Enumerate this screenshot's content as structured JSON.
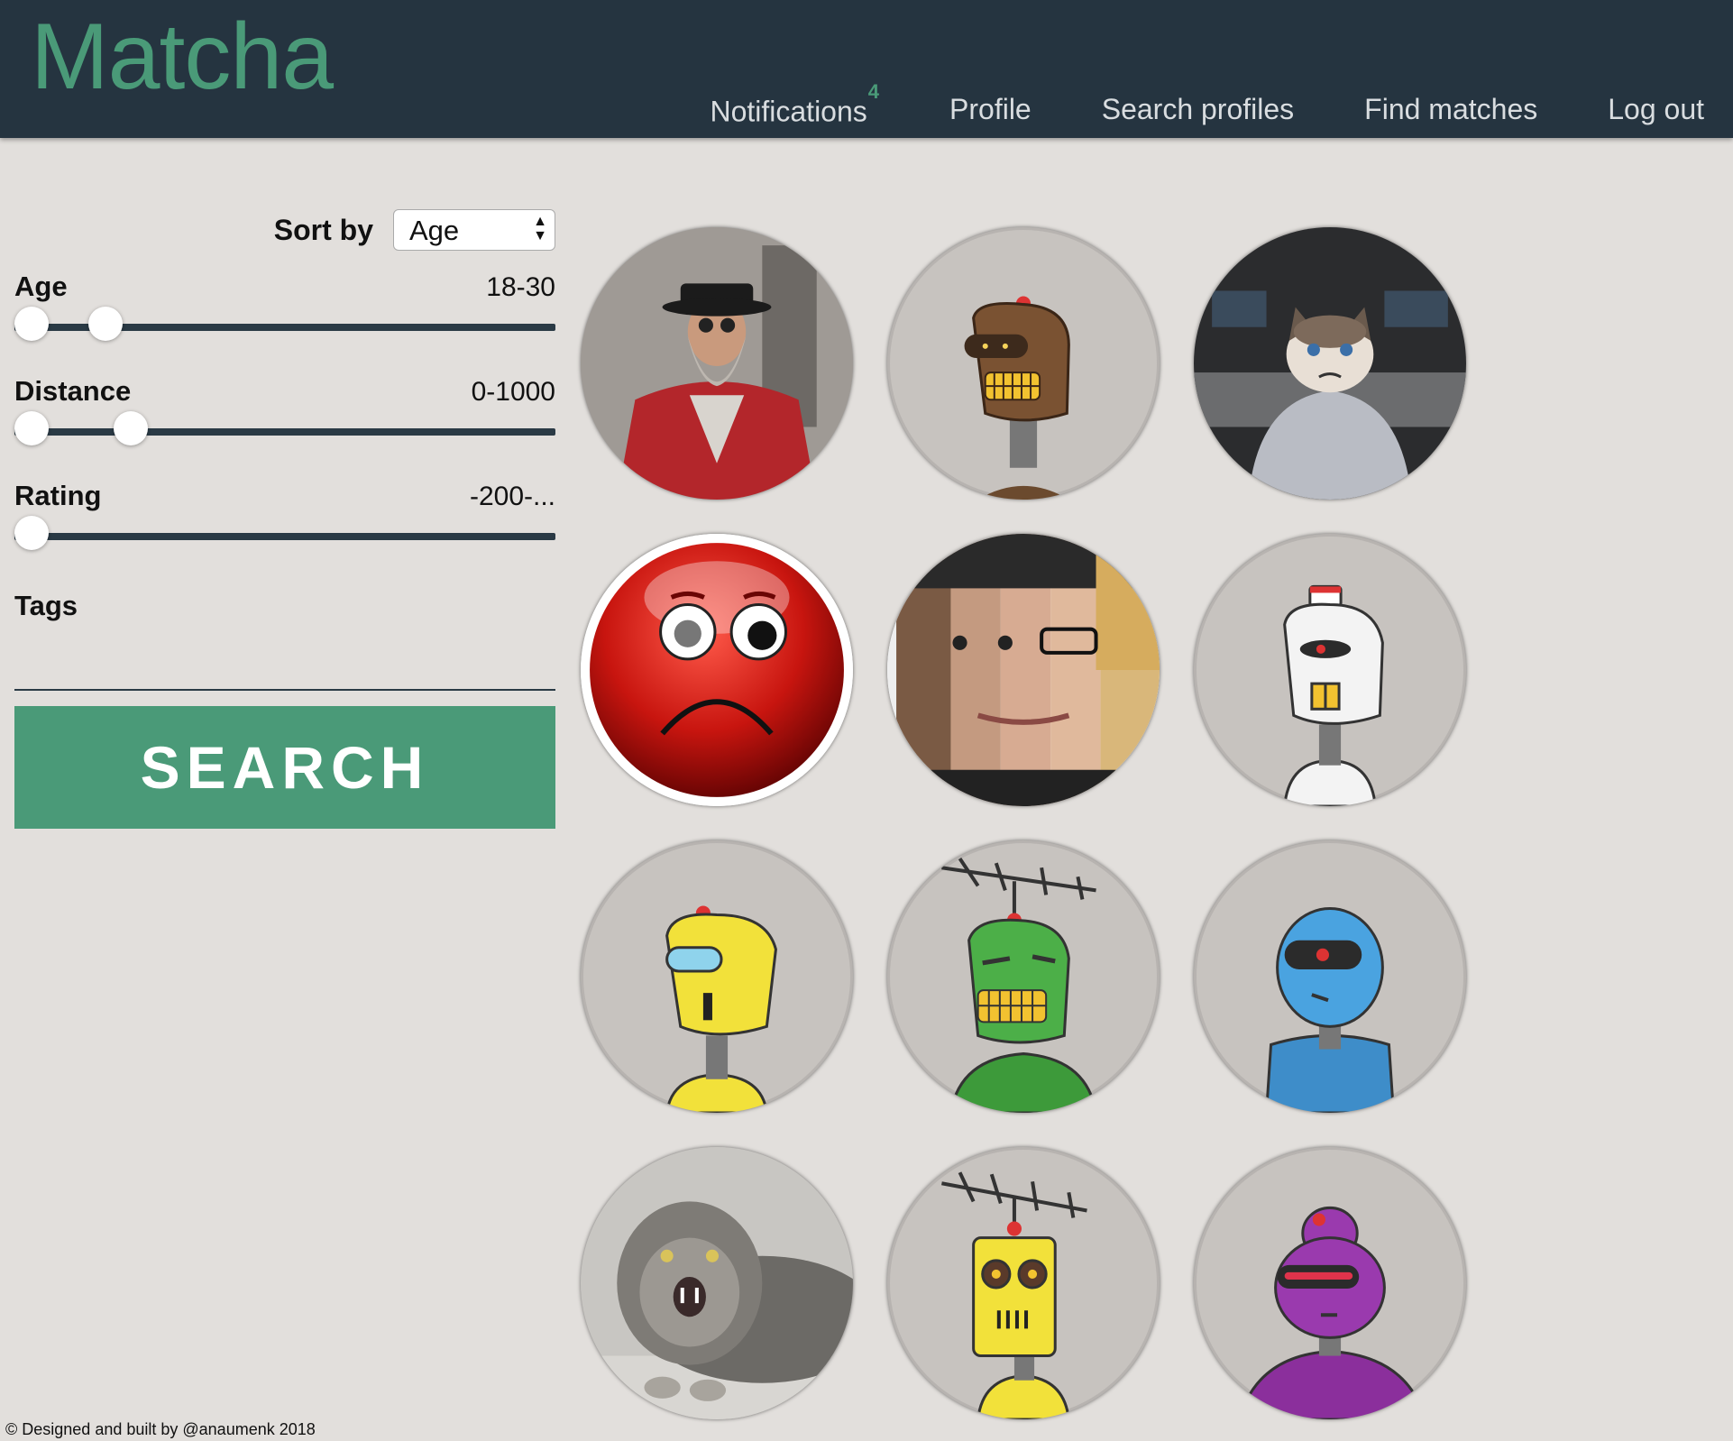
{
  "header": {
    "logo": "Matcha",
    "nav": [
      {
        "label": "Notifications",
        "badge": "4"
      },
      {
        "label": "Profile"
      },
      {
        "label": "Search profiles"
      },
      {
        "label": "Find matches"
      },
      {
        "label": "Log out"
      }
    ]
  },
  "sidebar": {
    "sort_label": "Sort by",
    "sort_selected": "Age",
    "filters": {
      "age": {
        "label": "Age",
        "value": "18-30"
      },
      "distance": {
        "label": "Distance",
        "value": "0-1000"
      },
      "rating": {
        "label": "Rating",
        "value": "-200-..."
      }
    },
    "tags_label": "Tags",
    "tags_value": "",
    "search_label": "SEARCH"
  },
  "profiles": [
    {
      "avatar": "bearded-man-photo"
    },
    {
      "avatar": "brown-robot"
    },
    {
      "avatar": "grumpy-cat-person-photo"
    },
    {
      "avatar": "sad-red-emoji"
    },
    {
      "avatar": "faces-collage-photo"
    },
    {
      "avatar": "white-robot"
    },
    {
      "avatar": "yellow-robot"
    },
    {
      "avatar": "green-robot-antenna"
    },
    {
      "avatar": "blue-robot"
    },
    {
      "avatar": "pallas-cat-photo"
    },
    {
      "avatar": "yellow-robot-antenna"
    },
    {
      "avatar": "purple-robot"
    }
  ],
  "footer": {
    "text": "© Designed and built by @anaumenk 2018"
  },
  "colors": {
    "brand": "#4a9a78",
    "header_bg": "#253440",
    "page_bg": "#e2dfdc"
  }
}
